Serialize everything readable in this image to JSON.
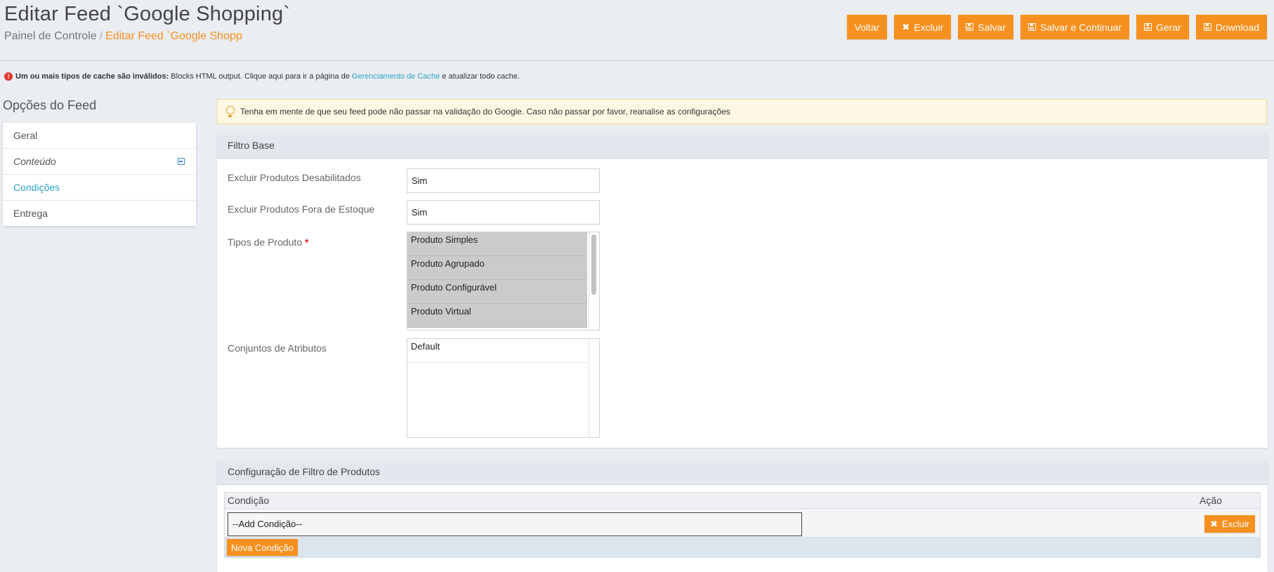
{
  "header": {
    "title": "Editar Feed `Google Shopping`",
    "breadcrumb": {
      "home": "Painel de Controle",
      "separator": "/",
      "current": "Editar Feed `Google Shopping`"
    },
    "buttons": {
      "back": "Voltar",
      "delete": "Excluir",
      "save": "Salvar",
      "save_continue": "Salvar e Continuar",
      "generate": "Gerar",
      "download": "Download"
    }
  },
  "notice": {
    "bold": "Um ou mais tipos de cache são inválidos:",
    "text_before": " Blocks HTML output. Clique aqui para ir a página de ",
    "link": "Gerenciamento de Cache",
    "text_after": " e atualizar todo cache."
  },
  "sidebar": {
    "title": "Opções do Feed",
    "items": [
      {
        "label": "Geral"
      },
      {
        "label": "Conteúdo"
      },
      {
        "label": "Condições"
      },
      {
        "label": "Entrega"
      }
    ]
  },
  "tip": "Tenha em mente de que seu feed pode não passar na validação do Google. Caso não passar por favor, reanalise as configurações",
  "filtro_base": {
    "title": "Filtro Base",
    "fields": {
      "exclude_disabled": {
        "label": "Excluir Produtos Desabilitados",
        "value": "Sim"
      },
      "exclude_out_of_stock": {
        "label": "Excluir Produtos Fora de Estoque",
        "value": "Sim"
      },
      "product_types": {
        "label": "Tipos de Produto",
        "required_mark": "*",
        "options": [
          "Produto Simples",
          "Produto Agrupado",
          "Produto Configurável",
          "Produto Virtual"
        ]
      },
      "attribute_sets": {
        "label": "Conjuntos de Atributos",
        "options": [
          "Default"
        ]
      }
    }
  },
  "filtro_produtos": {
    "title": "Configuração de Filtro de Produtos",
    "columns": {
      "condition": "Condição",
      "action": "Ação"
    },
    "row": {
      "select_value": "--Add Condição--",
      "delete_label": "Excluir"
    },
    "new_condition": "Nova Condição"
  },
  "colors": {
    "accent": "#f7901e",
    "link": "#2aa4c9",
    "required": "#e02020"
  }
}
